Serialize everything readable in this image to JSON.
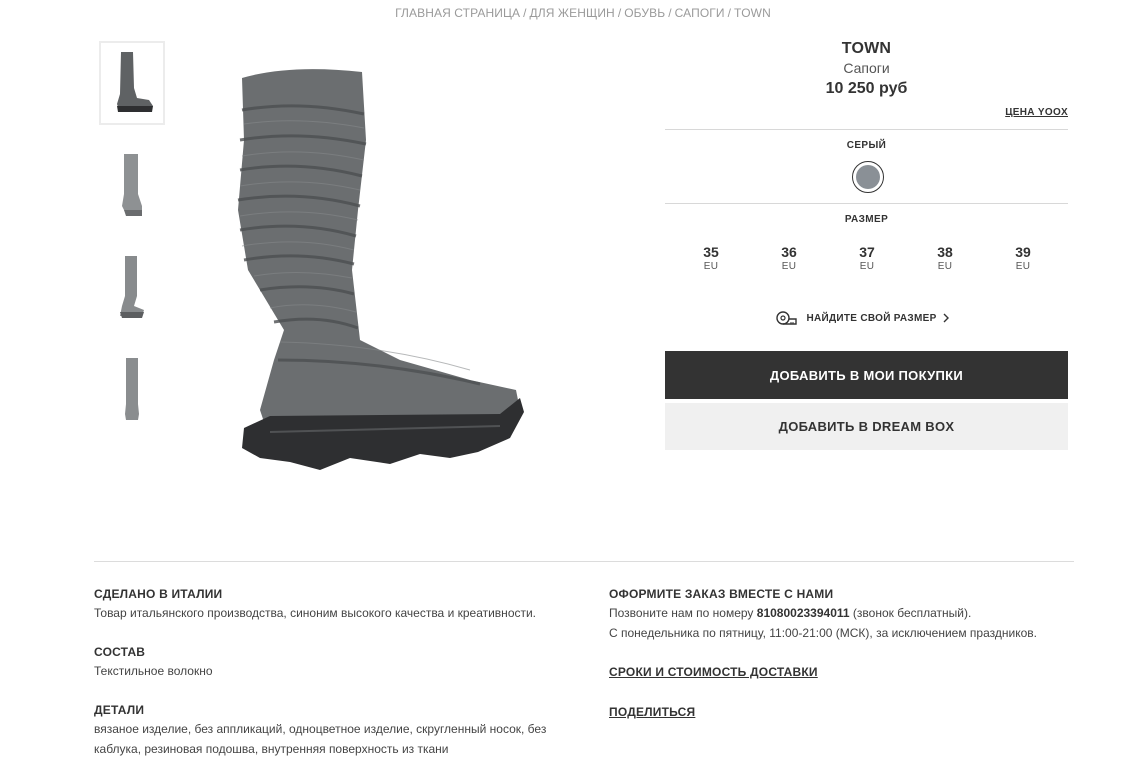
{
  "breadcrumb": {
    "items": [
      "ГЛАВНАЯ СТРАНИЦА",
      "ДЛЯ ЖЕНЩИН",
      "ОБУВЬ",
      "САПОГИ",
      "TOWN"
    ],
    "separator": "/"
  },
  "gallery": {
    "thumbnails": [
      "boot-side-view",
      "boot-front-view",
      "boot-back-view",
      "boot-sole-view"
    ],
    "main_image": "knit-sock-boot-gray"
  },
  "product": {
    "brand": "TOWN",
    "category": "Сапоги",
    "price": "10 250 руб",
    "price_link": "ЦЕНА YOOX"
  },
  "color": {
    "label": "СЕРЫЙ",
    "swatch_color": "#8a9096"
  },
  "size": {
    "label": "РАЗМЕР",
    "options": [
      {
        "value": "35",
        "unit": "EU"
      },
      {
        "value": "36",
        "unit": "EU"
      },
      {
        "value": "37",
        "unit": "EU"
      },
      {
        "value": "38",
        "unit": "EU"
      },
      {
        "value": "39",
        "unit": "EU"
      }
    ],
    "find_size": "НАЙДИТЕ СВОЙ РАЗМЕР",
    "find_size_icon": "measuring-tape-icon"
  },
  "actions": {
    "add_to_cart": "ДОБАВИТЬ В МОИ ПОКУПКИ",
    "add_to_dreambox": "ДОБАВИТЬ В DREAM BOX"
  },
  "details": {
    "made_in_title": "СДЕЛАНО В ИТАЛИИ",
    "made_in_text": "Товар итальянского производства, синоним высокого качества и креативности.",
    "composition_title": "СОСТАВ",
    "composition_text": "Текстильное волокно",
    "details_title": "ДЕТАЛИ",
    "details_text_1": "вязаное изделие, без аппликаций, одноцветное изделие, скругленный носок, без",
    "details_text_2": "каблука, резиновая подошва, внутренняя поверхность из ткани"
  },
  "order": {
    "title": "ОФОРМИТЕ ЗАКАЗ ВМЕСТЕ С НАМИ",
    "call_prefix": "Позвоните нам по номеру",
    "phone": "81080023394011",
    "call_suffix": "(звонок бесплатный).",
    "hours": "С понедельника по пятницу, 11:00-21:00 (МСК), за исключением праздников.",
    "delivery_link": "СРОКИ И СТОИМОСТЬ ДОСТАВКИ",
    "share_link": "ПОДЕЛИТЬСЯ"
  },
  "colors": {
    "primary_button": "#333333",
    "secondary_button": "#f0f0f0",
    "boot_knit": "#6b6e70",
    "boot_sole": "#2e2f31"
  }
}
